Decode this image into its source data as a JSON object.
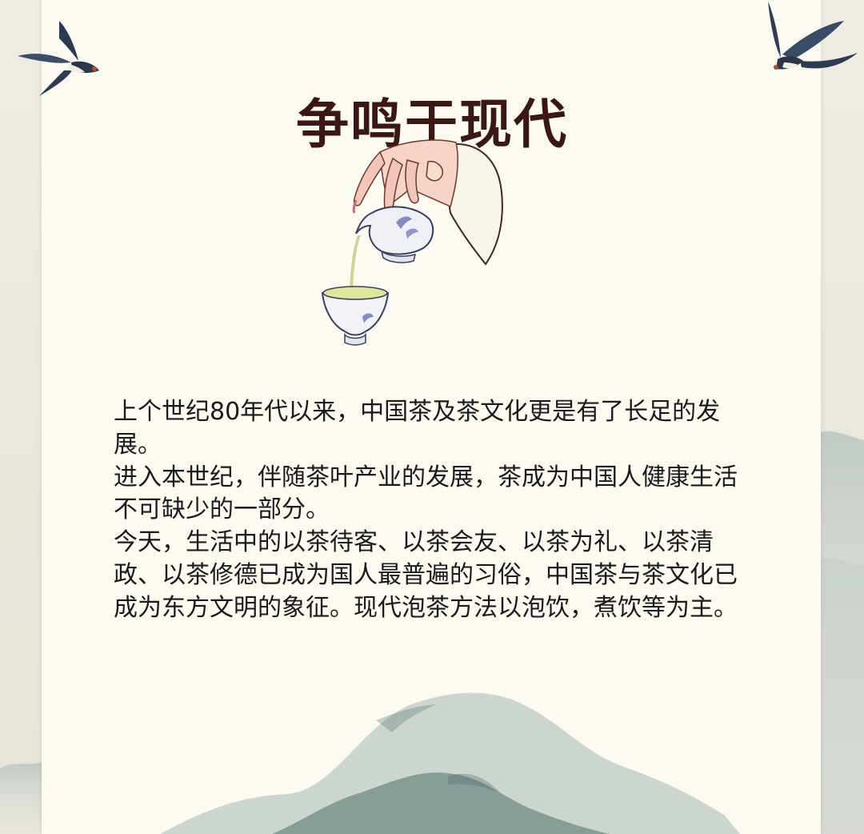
{
  "header": {
    "title": "争鸣于现代"
  },
  "article": {
    "paragraphs": [
      "上个世纪80年代以来，中国茶及茶文化更是有了长足的发展。",
      "进入本世纪，伴随茶叶产业的发展，茶成为中国人健康生活不可缺少的一部分。",
      "今天，生活中的以茶待客、以茶会友、以茶为礼、以茶清政、以茶修德已成为国人最普遍的习俗，中国茶与茶文化已成为东方文明的象征。现代泡茶方法以泡饮，煮饮等为主。"
    ]
  },
  "illustrations": {
    "center": "hand-pouring-tea-illustration",
    "corners": "swallow-bird-illustration",
    "footer": "ink-mountain-landscape"
  },
  "colors": {
    "panel": "#fcfaf1",
    "title": "#3a1814",
    "text": "#1a1a1a",
    "mountain": "#7e9896"
  }
}
